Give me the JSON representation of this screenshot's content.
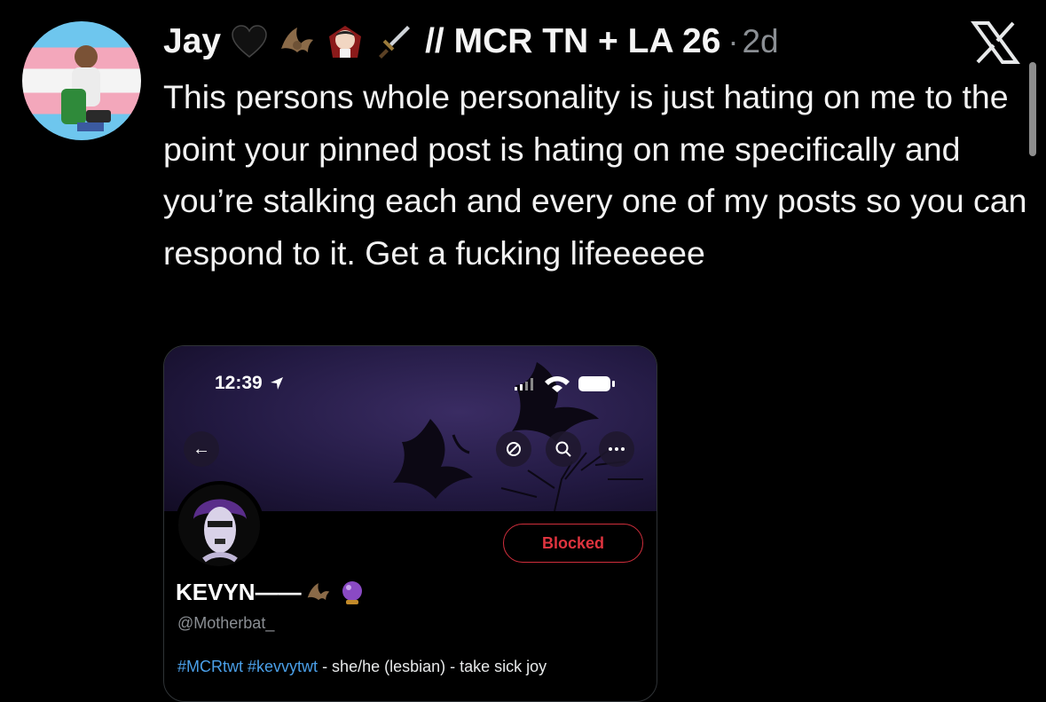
{
  "post": {
    "author_name": "Jay",
    "title_suffix": "// MCR TN + LA 26",
    "separator": "·",
    "timestamp": "2d",
    "emojis": [
      "black-heart-icon",
      "bat-icon",
      "vampire-icon",
      "dagger-icon"
    ],
    "text": "This persons whole personality is just hating on me to the point your pinned post is hating on me specifically and you’re stalking each and every one of my posts so you can respond to it. Get a fucking lifeeeeee",
    "avatar_flag_colors": [
      "#6ec6ee",
      "#f3a7bb",
      "#f4f4f4"
    ]
  },
  "window": {
    "close_icon": "x-logo-icon"
  },
  "screenshot": {
    "status_time": "12:39",
    "profile": {
      "name": "KEVYN",
      "name_decoration": "——",
      "handle": "@Motherbat_",
      "bio_tag_1": "#MCRtwt",
      "bio_tag_2": "#kevvytwt",
      "bio_rest": " - she/he (lesbian) - take sick joy",
      "blocked_label": "Blocked",
      "blocked_color": "#e0343f"
    }
  }
}
